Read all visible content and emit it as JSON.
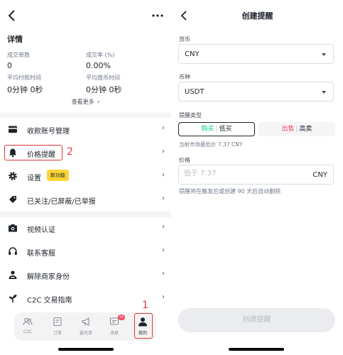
{
  "left": {
    "section_title": "详情",
    "stats": {
      "orders_label": "成交单数",
      "orders_value": "0",
      "rate_label": "成交率 (%)",
      "rate_value": "0.00%",
      "pay_label": "平均付款时间",
      "pay_value": "0分钟 0秒",
      "release_label": "平均放币时间",
      "release_value": "0分钟 0秒"
    },
    "view_more": "查看更多",
    "menu": [
      {
        "label": "收款账号管理",
        "icon": "wallet-icon"
      },
      {
        "label": "价格提醒",
        "icon": "bell-icon"
      },
      {
        "label": "设置",
        "icon": "gear-icon",
        "badge": "新功能"
      },
      {
        "label": "已关注/已屏蔽/已举报",
        "icon": "tag-icon"
      },
      {
        "label": "视频认证",
        "icon": "camera-icon"
      },
      {
        "label": "联系客服",
        "icon": "headset-icon"
      },
      {
        "label": "解除商家身份",
        "icon": "user-remove-icon"
      },
      {
        "label": "C2C 交易指南",
        "icon": "sprout-icon"
      }
    ],
    "annotations": {
      "step1": "1",
      "step2": "2",
      "accent": "#e0383b"
    },
    "tabs": [
      {
        "label": "C2C",
        "icon": "people-icon"
      },
      {
        "label": "订单",
        "icon": "order-icon"
      },
      {
        "label": "委托单",
        "icon": "megaphone-icon"
      },
      {
        "label": "消息",
        "icon": "message-icon",
        "badge": "18"
      },
      {
        "label": "我的",
        "icon": "profile-icon",
        "active": true
      }
    ]
  },
  "right": {
    "title": "创建提醒",
    "currency_label": "货币",
    "currency_value": "CNY",
    "coin_label": "币种",
    "coin_value": "USDT",
    "type_label": "提醒类型",
    "buy_word": "购买",
    "buy_text": "低买",
    "sell_word": "出售",
    "sell_text": "高卖",
    "market_hint": "当前市场最低价 7.37 CNY",
    "price_label": "价格",
    "price_placeholder": "低于 7.37",
    "price_unit": "CNY",
    "price_note": "提醒将在触发后或创建 90 天后自动删除",
    "create_button": "创建提醒",
    "colors": {
      "buy": "#0ecb81",
      "sell": "#f6465d",
      "badge": "#fcd535"
    }
  }
}
